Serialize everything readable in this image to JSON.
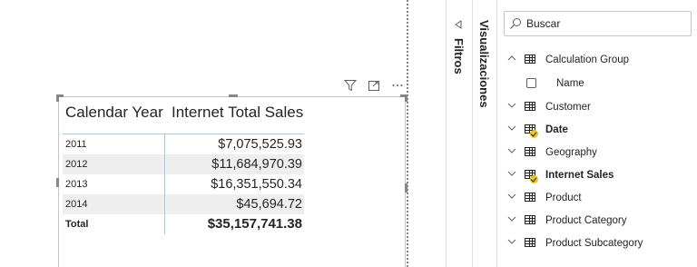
{
  "visual": {
    "headers": {
      "year": "Calendar Year",
      "sales": "Internet Total Sales"
    },
    "rows": [
      {
        "year": "2011",
        "value": "$7,075,525.93"
      },
      {
        "year": "2012",
        "value": "$11,684,970.39"
      },
      {
        "year": "2013",
        "value": "$16,351,550.34"
      },
      {
        "year": "2014",
        "value": "$45,694.72"
      }
    ],
    "total": {
      "label": "Total",
      "value": "$35,157,741.38"
    },
    "header_icons": [
      "filter-icon",
      "focus-mode-icon",
      "more-options-icon"
    ]
  },
  "panes": {
    "filters_label": "Filtros",
    "visualizations_label": "Visualizaciones"
  },
  "fields": {
    "search_placeholder": "Buscar",
    "calculation_group": {
      "label": "Calculation Group",
      "child": "Name"
    },
    "tables": [
      {
        "label": "Customer",
        "checked": false
      },
      {
        "label": "Date",
        "checked": true
      },
      {
        "label": "Geography",
        "checked": false
      },
      {
        "label": "Internet Sales",
        "checked": true
      },
      {
        "label": "Product",
        "checked": false
      },
      {
        "label": "Product Category",
        "checked": false
      },
      {
        "label": "Product Subcategory",
        "checked": false
      }
    ]
  },
  "colors": {
    "accent_check": "#f2c811",
    "grid_line": "#9ec9e8",
    "row_shade": "#eeeeee"
  }
}
